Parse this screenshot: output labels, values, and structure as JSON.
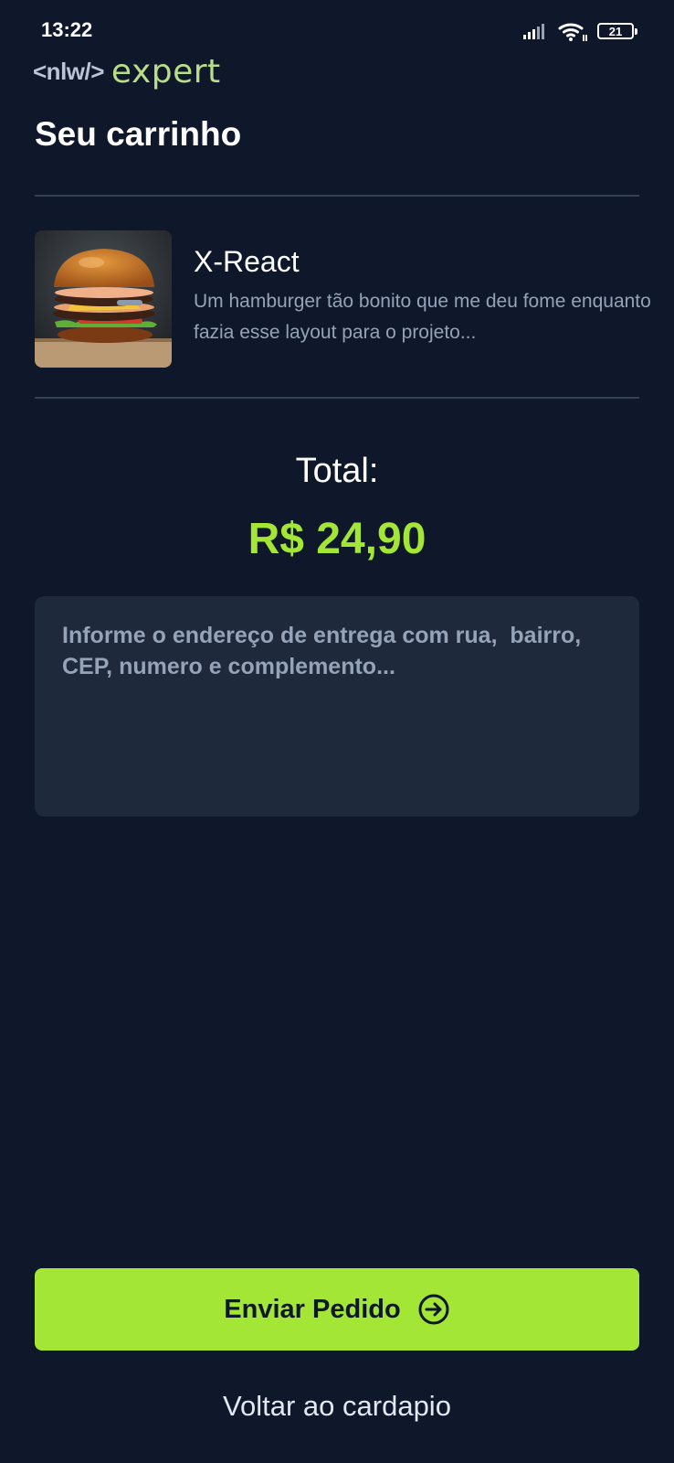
{
  "status_bar": {
    "time": "13:22",
    "battery": "21",
    "icons": [
      "signal-icon",
      "wifi-icon",
      "battery-icon"
    ]
  },
  "header": {
    "logo_left": "<nlw/>",
    "logo_right": "expert",
    "title": "Seu carrinho"
  },
  "cart": {
    "items": [
      {
        "name": "X-React",
        "description_line1": "Um hamburger tão bonito que me deu fome enquanto",
        "description_line2": "fazia esse layout para o projeto...",
        "image": "hamburger-image"
      }
    ]
  },
  "summary": {
    "total_label": "Total:",
    "total_value": "R$ 24,90"
  },
  "address": {
    "placeholder": "Informe o endereço de entrega com rua,  bairro, CEP, numero e complemento...",
    "value": ""
  },
  "actions": {
    "send_label": "Enviar Pedido",
    "send_icon": "arrow-circle-right-icon",
    "back_label": "Voltar ao cardapio"
  },
  "colors": {
    "background": "#0f172a",
    "accent": "#a3e635",
    "input_background": "#1e293b",
    "muted_text": "#94a3b8"
  }
}
